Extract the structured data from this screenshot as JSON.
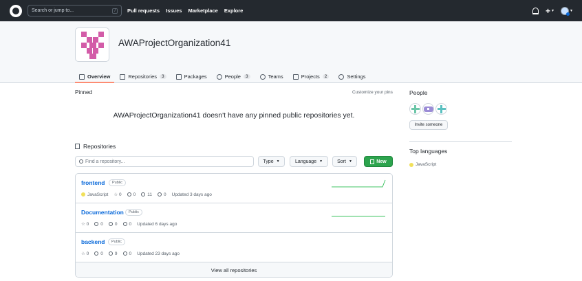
{
  "header": {
    "search_placeholder": "Search or jump to...",
    "search_shortcut": "/",
    "nav": [
      "Pull requests",
      "Issues",
      "Marketplace",
      "Explore"
    ],
    "plus_label": "+"
  },
  "org": {
    "name": "AWAProjectOrganization41",
    "tabs": [
      {
        "label": "Overview",
        "count": ""
      },
      {
        "label": "Repositories",
        "count": "3"
      },
      {
        "label": "Packages",
        "count": ""
      },
      {
        "label": "People",
        "count": "3"
      },
      {
        "label": "Teams",
        "count": ""
      },
      {
        "label": "Projects",
        "count": "2"
      },
      {
        "label": "Settings",
        "count": ""
      }
    ]
  },
  "pinned": {
    "title": "Pinned",
    "customize": "Customize your pins",
    "empty_message": "AWAProjectOrganization41 doesn't have any pinned public repositories yet."
  },
  "repositories": {
    "title": "Repositories",
    "find_placeholder": "Find a repository...",
    "type_label": "Type",
    "language_label": "Language",
    "sort_label": "Sort",
    "new_label": "New",
    "view_all": "View all repositories",
    "items": [
      {
        "name": "frontend",
        "visibility": "Public",
        "language": "JavaScript",
        "stars": "0",
        "forks": "0",
        "issues": "11",
        "prs": "0",
        "updated": "Updated 3 days ago"
      },
      {
        "name": "Documentation",
        "visibility": "Public",
        "language": "",
        "stars": "0",
        "forks": "0",
        "issues": "0",
        "prs": "0",
        "updated": "Updated 6 days ago"
      },
      {
        "name": "backend",
        "visibility": "Public",
        "language": "",
        "stars": "0",
        "forks": "0",
        "issues": "9",
        "prs": "0",
        "updated": "Updated 23 days ago"
      }
    ]
  },
  "sidebar": {
    "people_title": "People",
    "invite_label": "Invite someone",
    "languages_title": "Top languages",
    "languages": [
      "JavaScript"
    ]
  },
  "colors": {
    "header_bg": "#24292f",
    "link": "#0969da",
    "new_button": "#2da44e",
    "tab_underline": "#fd8c73",
    "javascript": "#f1e05a",
    "org_avatar": "#d35ca8"
  }
}
